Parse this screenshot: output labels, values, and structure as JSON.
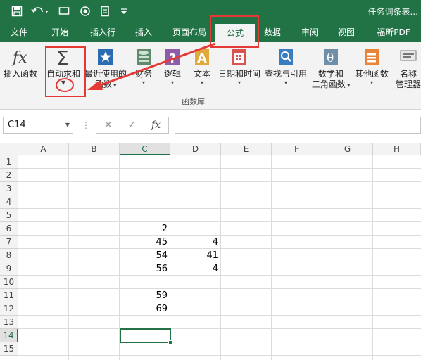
{
  "titlebar": {
    "title": "任务词条表...",
    "save_icon": "save-icon",
    "undo_icon": "undo-icon",
    "monitor_icon": "screen-icon",
    "target_icon": "target-icon",
    "touch_icon": "touch-icon",
    "customize_icon": "customize-icon"
  },
  "tabs": [
    {
      "label": "文件"
    },
    {
      "label": "开始"
    },
    {
      "label": "插入行"
    },
    {
      "label": "插入"
    },
    {
      "label": "页面布局"
    },
    {
      "label": "公式"
    },
    {
      "label": "数据"
    },
    {
      "label": "审阅"
    },
    {
      "label": "视图"
    },
    {
      "label": "福昕PDF"
    }
  ],
  "ribbon": {
    "insert_function": {
      "label": "插入函数",
      "icon": "fx-icon"
    },
    "autosum": {
      "label": "自动求和",
      "icon": "sigma-icon"
    },
    "recent": {
      "label1": "最近使用的",
      "label2": "函数",
      "icon": "star-icon"
    },
    "financial": {
      "label": "财务",
      "icon": "financial-icon"
    },
    "logical": {
      "label": "逻辑",
      "icon": "question-icon"
    },
    "text": {
      "label": "文本",
      "icon": "text-icon"
    },
    "datetime": {
      "label": "日期和时间",
      "icon": "calendar-icon"
    },
    "lookup": {
      "label": "查找与引用",
      "icon": "magnifier-icon"
    },
    "math": {
      "label1": "数学和",
      "label2": "三角函数",
      "icon": "theta-icon"
    },
    "more": {
      "label": "其他函数",
      "icon": "more-functions-icon"
    },
    "name_manager": {
      "label1": "名称",
      "label2": "管理器",
      "icon": "name-manager-icon"
    },
    "group_label": "函数库"
  },
  "formula_bar": {
    "name_box": "C14",
    "cancel_icon": "✕",
    "enter_icon": "✓",
    "fx_icon": "fx",
    "formula": ""
  },
  "columns": [
    "A",
    "B",
    "C",
    "D",
    "E",
    "F",
    "G",
    "H"
  ],
  "rows": [
    "1",
    "2",
    "3",
    "4",
    "5",
    "6",
    "7",
    "8",
    "9",
    "10",
    "11",
    "12",
    "13",
    "14",
    "15"
  ],
  "selected_cell": "C14",
  "cell_values": {
    "C6": "2",
    "C7": "45",
    "D7": "4",
    "C8": "54",
    "D8": "41",
    "C9": "56",
    "D9": "4",
    "C11": "59",
    "C12": "69"
  },
  "colors": {
    "accent": "#217346",
    "annotation": "#e53935"
  }
}
